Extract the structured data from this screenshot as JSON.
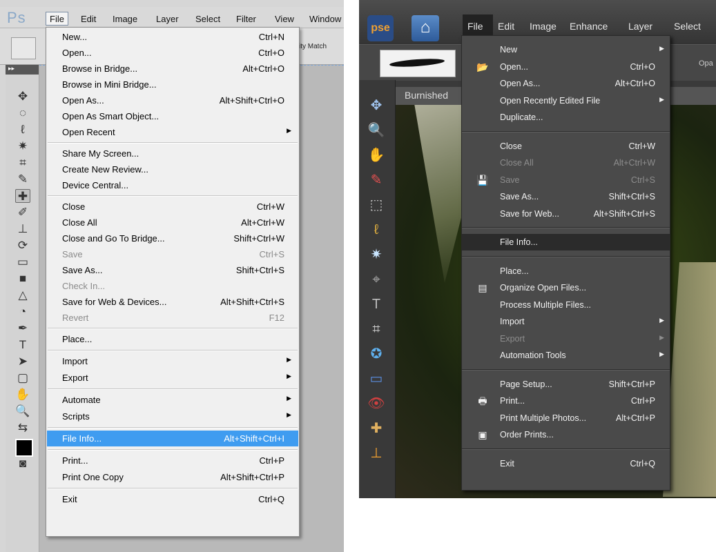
{
  "photoshop": {
    "logo": "Ps",
    "menubar": [
      "File",
      "Edit",
      "Image",
      "Layer",
      "Select",
      "Filter",
      "View",
      "Window"
    ],
    "options_text": "ity Match",
    "file_menu": [
      {
        "label": "New...",
        "shortcut": "Ctrl+N"
      },
      {
        "label": "Open...",
        "shortcut": "Ctrl+O"
      },
      {
        "label": "Browse in Bridge...",
        "shortcut": "Alt+Ctrl+O"
      },
      {
        "label": "Browse in Mini Bridge...",
        "shortcut": ""
      },
      {
        "label": "Open As...",
        "shortcut": "Alt+Shift+Ctrl+O"
      },
      {
        "label": "Open As Smart Object...",
        "shortcut": ""
      },
      {
        "label": "Open Recent",
        "shortcut": "",
        "submenu": true
      },
      {
        "sep": true
      },
      {
        "label": "Share My Screen...",
        "shortcut": ""
      },
      {
        "label": "Create New Review...",
        "shortcut": ""
      },
      {
        "label": "Device Central...",
        "shortcut": ""
      },
      {
        "sep": true
      },
      {
        "label": "Close",
        "shortcut": "Ctrl+W"
      },
      {
        "label": "Close All",
        "shortcut": "Alt+Ctrl+W"
      },
      {
        "label": "Close and Go To Bridge...",
        "shortcut": "Shift+Ctrl+W"
      },
      {
        "label": "Save",
        "shortcut": "Ctrl+S",
        "disabled": true
      },
      {
        "label": "Save As...",
        "shortcut": "Shift+Ctrl+S"
      },
      {
        "label": "Check In...",
        "shortcut": "",
        "disabled": true
      },
      {
        "label": "Save for Web & Devices...",
        "shortcut": "Alt+Shift+Ctrl+S"
      },
      {
        "label": "Revert",
        "shortcut": "F12",
        "disabled": true
      },
      {
        "sep": true
      },
      {
        "label": "Place...",
        "shortcut": ""
      },
      {
        "sep": true
      },
      {
        "label": "Import",
        "shortcut": "",
        "submenu": true
      },
      {
        "label": "Export",
        "shortcut": "",
        "submenu": true
      },
      {
        "sep": true
      },
      {
        "label": "Automate",
        "shortcut": "",
        "submenu": true
      },
      {
        "label": "Scripts",
        "shortcut": "",
        "submenu": true
      },
      {
        "sep": true
      },
      {
        "label": "File Info...",
        "shortcut": "Alt+Shift+Ctrl+I",
        "highlighted": true
      },
      {
        "sep": true
      },
      {
        "label": "Print...",
        "shortcut": "Ctrl+P"
      },
      {
        "label": "Print One Copy",
        "shortcut": "Alt+Shift+Ctrl+P"
      },
      {
        "sep": true
      },
      {
        "label": "Exit",
        "shortcut": "Ctrl+Q"
      }
    ],
    "tools": [
      "move-tool-icon",
      "marquee-tool-icon",
      "lasso-tool-icon",
      "magic-wand-tool-icon",
      "crop-tool-icon",
      "eyedropper-tool-icon",
      "healing-brush-tool-icon",
      "brush-tool-icon",
      "clone-stamp-tool-icon",
      "history-brush-tool-icon",
      "eraser-tool-icon",
      "gradient-tool-icon",
      "blur-tool-icon",
      "dodge-tool-icon",
      "pen-tool-icon",
      "type-tool-icon",
      "path-selection-tool-icon",
      "shape-tool-icon",
      "hand-tool-icon",
      "zoom-tool-icon",
      "swap-colors-icon",
      "foreground-color-swatch",
      "quick-mask-icon"
    ]
  },
  "elements": {
    "logo": "pse",
    "menubar": [
      "File",
      "Edit",
      "Image",
      "Enhance",
      "Layer",
      "Select"
    ],
    "options_text": "Opa",
    "document_tab": "Burnished",
    "file_menu": [
      {
        "label": "New",
        "shortcut": "",
        "submenu": true
      },
      {
        "label": "Open...",
        "shortcut": "Ctrl+O",
        "icon": "folder-icon"
      },
      {
        "label": "Open As...",
        "shortcut": "Alt+Ctrl+O"
      },
      {
        "label": "Open Recently Edited File",
        "shortcut": "",
        "submenu": true
      },
      {
        "label": "Duplicate...",
        "shortcut": ""
      },
      {
        "sep": true
      },
      {
        "label": "Close",
        "shortcut": "Ctrl+W"
      },
      {
        "label": "Close All",
        "shortcut": "Alt+Ctrl+W",
        "disabled": true
      },
      {
        "label": "Save",
        "shortcut": "Ctrl+S",
        "disabled": true,
        "icon": "floppy-disk-icon"
      },
      {
        "label": "Save As...",
        "shortcut": "Shift+Ctrl+S"
      },
      {
        "label": "Save for Web...",
        "shortcut": "Alt+Shift+Ctrl+S"
      },
      {
        "sep": true
      },
      {
        "label": "File Info...",
        "shortcut": "",
        "highlighted": true
      },
      {
        "sep": true
      },
      {
        "label": "Place...",
        "shortcut": ""
      },
      {
        "label": "Organize Open Files...",
        "shortcut": "",
        "icon": "organize-grid-icon"
      },
      {
        "label": "Process Multiple Files...",
        "shortcut": ""
      },
      {
        "label": "Import",
        "shortcut": "",
        "submenu": true
      },
      {
        "label": "Export",
        "shortcut": "",
        "submenu": true,
        "disabled": true
      },
      {
        "label": "Automation Tools",
        "shortcut": "",
        "submenu": true
      },
      {
        "sep": true
      },
      {
        "label": "Page Setup...",
        "shortcut": "Shift+Ctrl+P"
      },
      {
        "label": "Print...",
        "shortcut": "Ctrl+P",
        "icon": "printer-icon"
      },
      {
        "label": "Print Multiple Photos...",
        "shortcut": "Alt+Ctrl+P"
      },
      {
        "label": "Order Prints...",
        "shortcut": "",
        "icon": "order-prints-icon"
      },
      {
        "sep": true
      },
      {
        "label": "Exit",
        "shortcut": "Ctrl+Q"
      }
    ],
    "tools": [
      "move-tool-icon",
      "zoom-tool-icon",
      "hand-tool-icon",
      "eyedropper-tool-icon",
      "marquee-tool-icon",
      "lasso-tool-icon",
      "magic-wand-tool-icon",
      "quick-selection-tool-icon",
      "type-tool-icon",
      "crop-tool-icon",
      "cookie-cutter-tool-icon",
      "straighten-tool-icon",
      "red-eye-tool-icon",
      "healing-brush-tool-icon",
      "clone-stamp-tool-icon"
    ]
  },
  "colors": {
    "ps_highlight": "#3f9cf0",
    "pse_menu_bg": "#4a4a4a",
    "pse_highlight": "#2b2b2b"
  }
}
